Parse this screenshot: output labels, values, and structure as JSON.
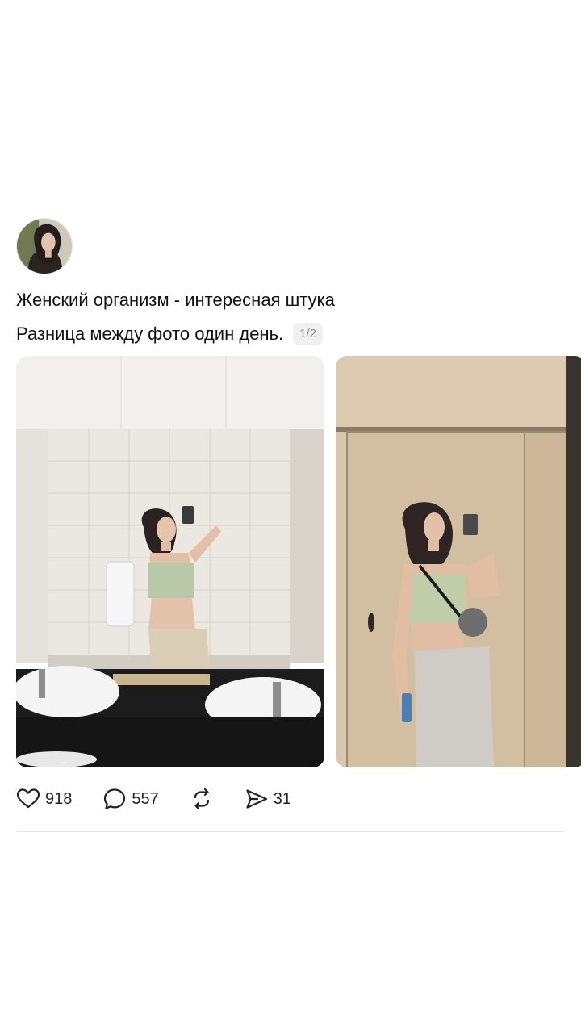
{
  "post": {
    "text_line_1": "Женский организм - интересная штука",
    "text_line_2": "Разница между фото один день.",
    "carousel_counter": "1/2",
    "avatar_icon": "user-avatar",
    "photos": [
      {
        "name": "photo-1",
        "icon": "mirror-selfie-photo"
      },
      {
        "name": "photo-2",
        "icon": "mirror-selfie-photo"
      }
    ],
    "actions": {
      "like": {
        "icon": "heart-icon",
        "count": "918"
      },
      "comment": {
        "icon": "comment-icon",
        "count": "557"
      },
      "repost": {
        "icon": "repost-icon"
      },
      "share": {
        "icon": "send-icon",
        "count": "31"
      }
    }
  },
  "colors": {
    "background": "#ffffff",
    "text": "#111111",
    "counter_bg": "#f0f0f0",
    "counter_text": "#8a8a8a",
    "divider": "#e8e8e8"
  }
}
